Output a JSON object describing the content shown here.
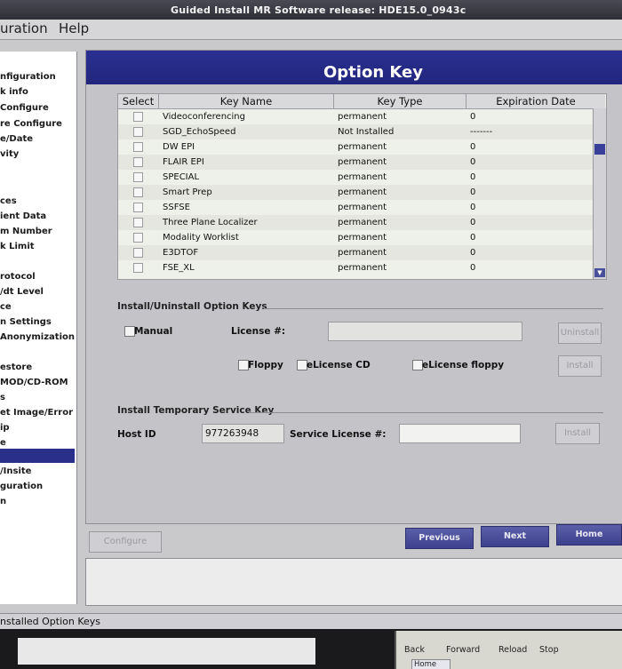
{
  "titlebar": {
    "title": "Guided Install  MR Software release: HDE15.0_0943c"
  },
  "menubar": {
    "items": [
      "uration",
      "Help"
    ]
  },
  "sidebar": {
    "items": [
      "nfiguration",
      "k info",
      "Configure",
      "re Configure",
      "e/Date",
      "vity",
      "",
      "",
      "ces",
      "ient Data",
      "m Number",
      "k Limit",
      "",
      "rotocol",
      "/dt Level",
      "ce",
      "n Settings",
      "Anonymization S",
      "",
      "estore",
      "MOD/CD-ROM",
      "s",
      "et Image/Error DE",
      "ip",
      "e",
      "",
      "/Insite",
      "guration",
      "n"
    ]
  },
  "page": {
    "title": "Option Key"
  },
  "table": {
    "headers": [
      "Select",
      "Key Name",
      "Key Type",
      "Expiration Date"
    ],
    "rows": [
      {
        "name": "Videoconferencing",
        "type": "permanent",
        "exp": "0"
      },
      {
        "name": "SGD_EchoSpeed",
        "type": "Not Installed",
        "exp": "-------"
      },
      {
        "name": "DW EPI",
        "type": "permanent",
        "exp": "0"
      },
      {
        "name": "FLAIR EPI",
        "type": "permanent",
        "exp": "0"
      },
      {
        "name": "SPECIAL",
        "type": "permanent",
        "exp": "0"
      },
      {
        "name": "Smart Prep",
        "type": "permanent",
        "exp": "0"
      },
      {
        "name": "SSFSE",
        "type": "permanent",
        "exp": "0"
      },
      {
        "name": "Three Plane Localizer",
        "type": "permanent",
        "exp": "0"
      },
      {
        "name": "Modality Worklist",
        "type": "permanent",
        "exp": "0"
      },
      {
        "name": "E3DTOF",
        "type": "permanent",
        "exp": "0"
      },
      {
        "name": "FSE_XL",
        "type": "permanent",
        "exp": "0"
      }
    ]
  },
  "install": {
    "section_title": "Install/Uninstall Option Keys",
    "manual_label": "Manual",
    "license_label": "License #:",
    "license_value": "",
    "uninstall_button": "Uninstall",
    "floppy_label": "Floppy",
    "elicense_cd_label": "eLicense CD",
    "elicense_floppy_label": "eLicense floppy",
    "install_button": "Install"
  },
  "temp": {
    "section_title": "Install Temporary Service Key",
    "host_id_label": "Host ID",
    "host_id_value": "977263948",
    "service_license_label": "Service License #:",
    "service_license_value": "",
    "install_button": "Install"
  },
  "nav": {
    "configure": "Configure",
    "previous": "Previous",
    "next": "Next",
    "home": "Home"
  },
  "statusbar": {
    "text": "nstalled Option Keys"
  },
  "browser": {
    "back": "Back",
    "forward": "Forward",
    "reload": "Reload",
    "stop": "Stop",
    "home_tab": "Home"
  }
}
